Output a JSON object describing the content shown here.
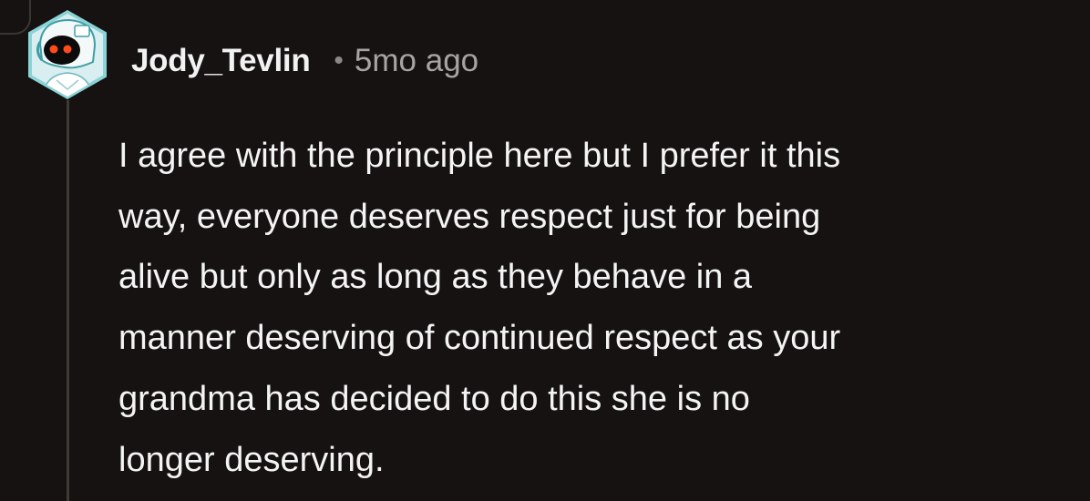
{
  "comment": {
    "author": "Jody_Tevlin",
    "separator": "•",
    "timestamp": "5mo ago",
    "body": "I agree with the principle here but I prefer it this\nway, everyone deserves respect just for being\nalive but only as long as they behave in a\nmanner deserving of continued respect as your\ngrandma has decided to do this she is no\nlonger deserving."
  },
  "avatar": {
    "icon": "robot-avatar-icon",
    "frame_color": "#8ad3d6",
    "background_color": "#d9eef0"
  },
  "colors": {
    "background": "#161211",
    "author_text": "#f2f2f2",
    "meta_text": "#a8a4a2",
    "body_text": "#f4f4f4",
    "thread_line": "#3e3a38"
  }
}
